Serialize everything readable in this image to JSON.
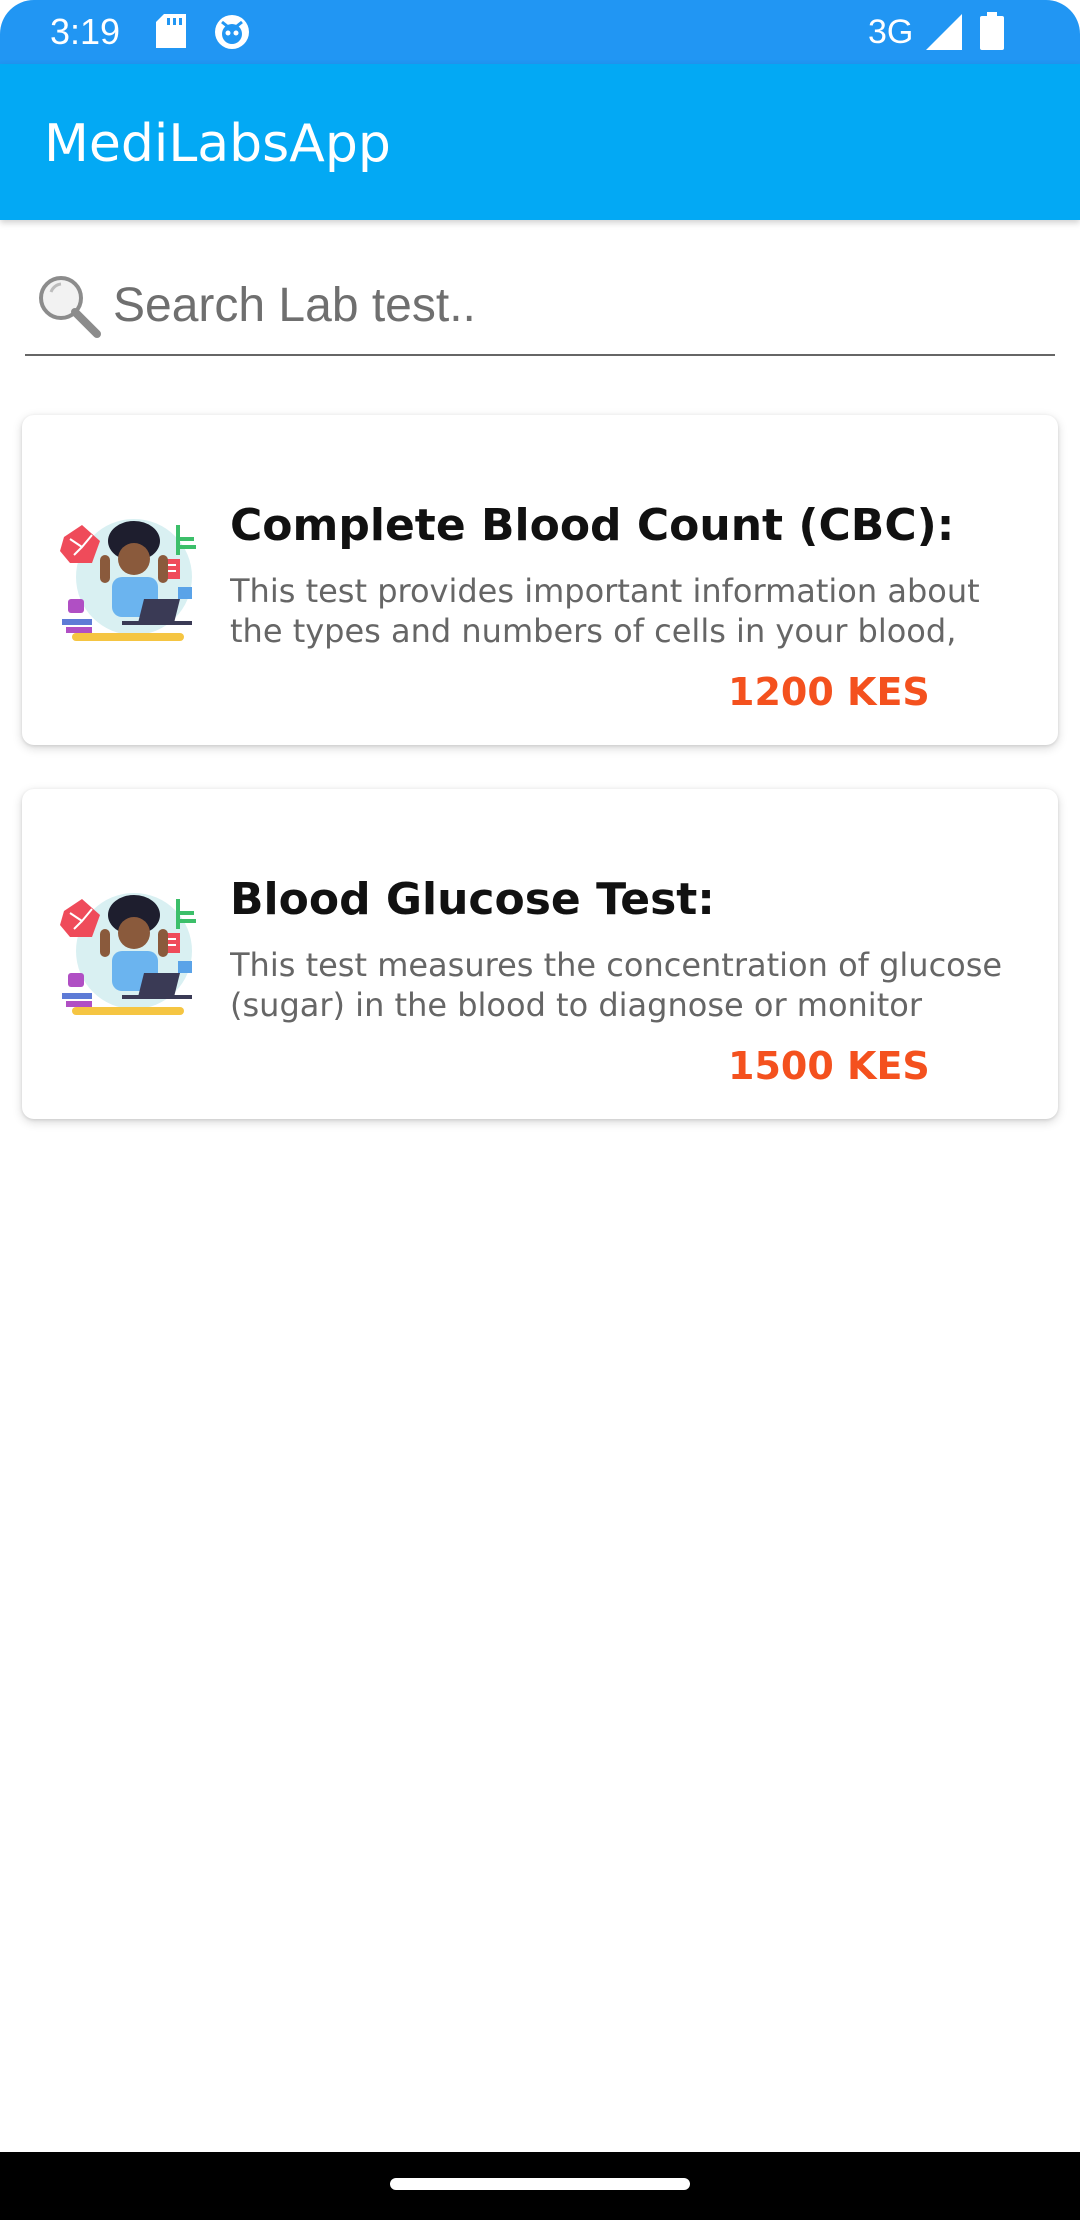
{
  "status_bar": {
    "time": "3:19",
    "network": "3G",
    "icons": [
      "sd-card-icon",
      "notification-face-icon",
      "signal-icon",
      "battery-icon"
    ]
  },
  "app_bar": {
    "title": "MediLabsApp"
  },
  "search": {
    "placeholder": "Search Lab test.."
  },
  "lab_tests": [
    {
      "title": "Complete Blood Count (CBC):",
      "description": "This test provides important information about the types and numbers of cells in your blood,",
      "price": "1200 KES"
    },
    {
      "title": "Blood Glucose Test:",
      "description": "This test measures the concentration of glucose (sugar) in the blood to diagnose or monitor",
      "price": "1500 KES"
    }
  ],
  "colors": {
    "status_bar": "#2196f3",
    "app_bar": "#03a9f4",
    "price": "#f4511e"
  }
}
